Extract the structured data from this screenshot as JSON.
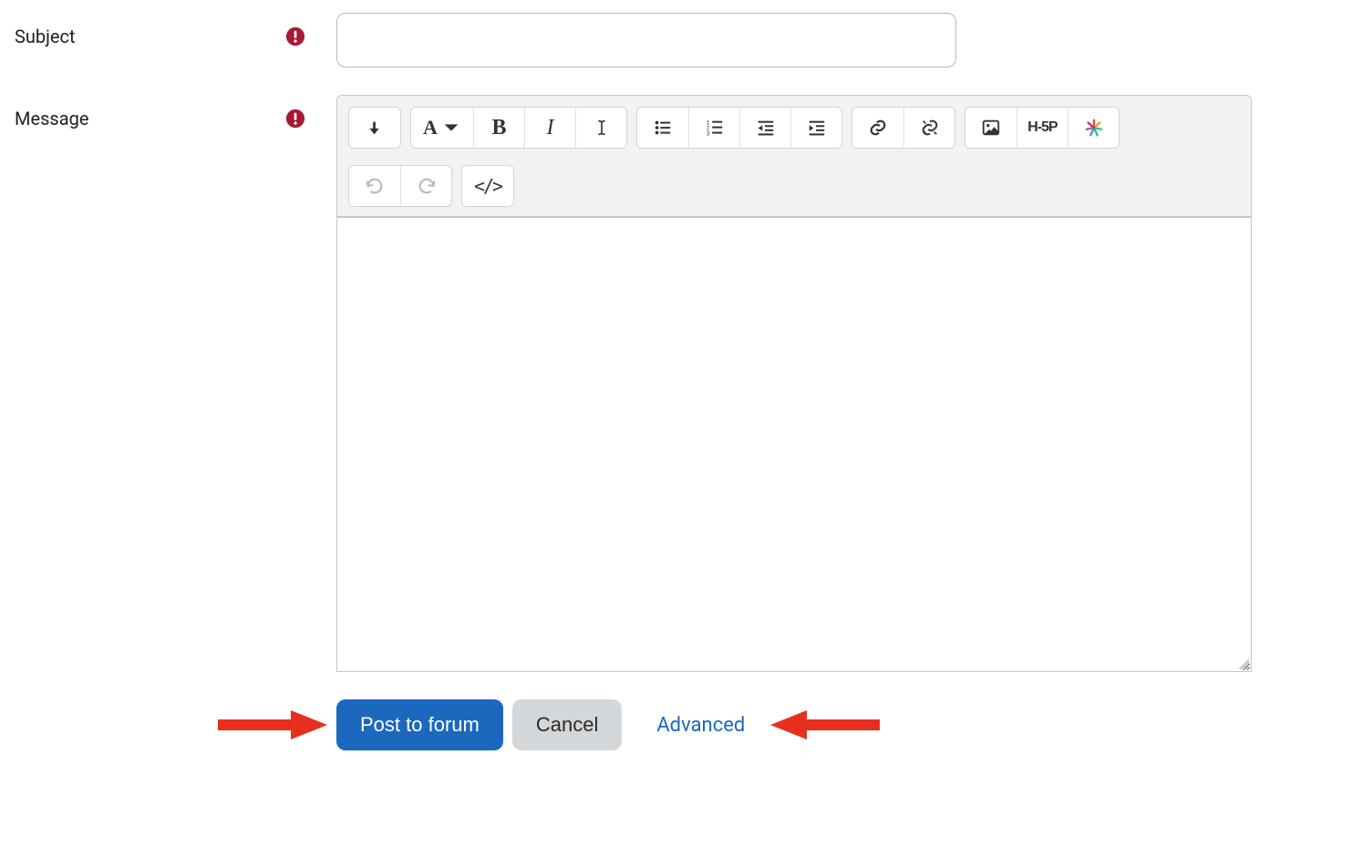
{
  "fields": {
    "subject": {
      "label": "Subject",
      "value": ""
    },
    "message": {
      "label": "Message",
      "value": ""
    }
  },
  "toolbar": {
    "h5p": "H-5P"
  },
  "buttons": {
    "submit": "Post to forum",
    "cancel": "Cancel",
    "advanced": "Advanced"
  },
  "colors": {
    "primary": "#1b68be",
    "required": "#a71932",
    "arrow": "#e72f1d"
  }
}
